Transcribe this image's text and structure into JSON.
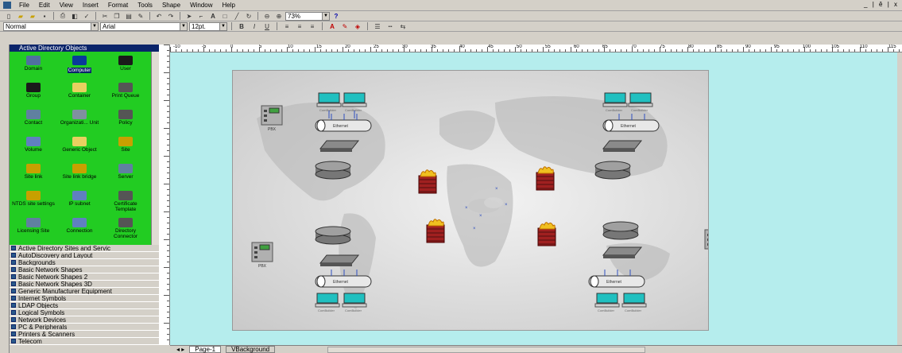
{
  "menu": {
    "items": [
      "File",
      "Edit",
      "View",
      "Insert",
      "Format",
      "Tools",
      "Shape",
      "Window",
      "Help"
    ],
    "window_controls": "_ | ê | x"
  },
  "toolbar": {
    "style": "Normal",
    "font": "Arial",
    "font_size": "12pt.",
    "zoom": "73%"
  },
  "stencil": {
    "title": "Active Directory Objects",
    "shapes": [
      {
        "label": "Domain",
        "icon": "domain-icon"
      },
      {
        "label": "Computer",
        "icon": "computer-icon",
        "selected": true
      },
      {
        "label": "User",
        "icon": "user-icon"
      },
      {
        "label": "Group",
        "icon": "group-icon"
      },
      {
        "label": "Container",
        "icon": "container-icon"
      },
      {
        "label": "Print Queue",
        "icon": "print-queue-icon"
      },
      {
        "label": "Contact",
        "icon": "contact-icon"
      },
      {
        "label": "Organizati... Unit",
        "icon": "org-unit-icon"
      },
      {
        "label": "Policy",
        "icon": "policy-icon"
      },
      {
        "label": "Volume",
        "icon": "volume-icon"
      },
      {
        "label": "Generic Object",
        "icon": "generic-object-icon"
      },
      {
        "label": "Site",
        "icon": "site-icon"
      },
      {
        "label": "Site link",
        "icon": "site-link-icon"
      },
      {
        "label": "Site link bridge",
        "icon": "site-link-bridge-icon"
      },
      {
        "label": "Server",
        "icon": "server-icon"
      },
      {
        "label": "NTDS site settings",
        "icon": "ntds-icon"
      },
      {
        "label": "IP subnet",
        "icon": "ip-subnet-icon"
      },
      {
        "label": "Certificate Template",
        "icon": "certificate-icon"
      },
      {
        "label": "Licensing Site",
        "icon": "licensing-icon"
      },
      {
        "label": "Connection",
        "icon": "connection-icon"
      },
      {
        "label": "Directory Connector",
        "icon": "directory-connector-icon"
      }
    ]
  },
  "stencil_list": [
    "Active Directory Sites and Servic",
    "AutoDiscovery and Layout",
    "Backgrounds",
    "Basic Network Shapes",
    "Basic Network Shapes 2",
    "Basic Network Shapes 3D",
    "Generic Manufacturer Equipment",
    "Internet Symbols",
    "LDAP Objects",
    "Logical Symbols",
    "Network Devices",
    "PC & Peripherals",
    "Printers & Scanners",
    "Telecom"
  ],
  "ruler_labels": [
    "-10",
    "-5",
    "0",
    "5",
    "10",
    "15",
    "20",
    "25",
    "30",
    "35",
    "40",
    "45",
    "50",
    "55",
    "60",
    "65",
    "70",
    "75",
    "80",
    "85",
    "90",
    "95",
    "100",
    "105",
    "110",
    "115"
  ],
  "page_tabs": [
    "Page-1",
    "VBackground"
  ],
  "diagram": {
    "pbx_label": "PBX",
    "computer_label": "ComBuilder",
    "ethernet_label": "Ethernet"
  }
}
